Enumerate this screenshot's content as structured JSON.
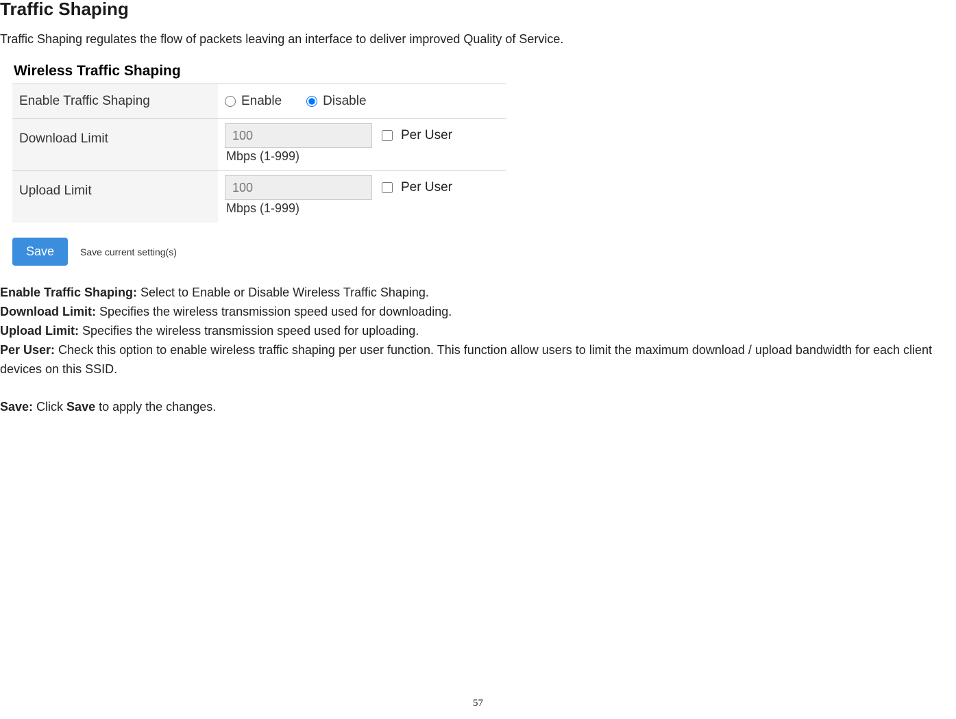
{
  "page": {
    "title": "Traffic Shaping",
    "intro": "Traffic Shaping regulates the flow of packets leaving an interface to deliver improved Quality of Service.",
    "pageNumber": "57"
  },
  "panel": {
    "heading": "Wireless Traffic Shaping",
    "enable": {
      "label": "Enable Traffic Shaping",
      "enableText": "Enable",
      "disableText": "Disable"
    },
    "download": {
      "label": "Download Limit",
      "value": "100",
      "unit": "Mbps (1-999)",
      "perUser": "Per User"
    },
    "upload": {
      "label": "Upload Limit",
      "value": "100",
      "unit": "Mbps (1-999)",
      "perUser": "Per User"
    },
    "saveButton": "Save",
    "saveHint": "Save current setting(s)"
  },
  "definitions": {
    "enableLabel": "Enable Traffic Shaping:",
    "enableText": " Select to Enable or Disable Wireless Traffic Shaping.",
    "downloadLabel": "Download Limit:",
    "downloadText": " Specifies the wireless transmission speed used for downloading.",
    "uploadLabel": "Upload Limit:",
    "uploadText": " Specifies the wireless transmission speed used for uploading.",
    "perUserLabel": "Per User:",
    "perUserText": " Check this option to enable wireless traffic shaping per user function. This function allow users to limit the maximum download / upload bandwidth for each client devices on this SSID.",
    "saveLabel": "Save:",
    "saveTextPrefix": " Click ",
    "saveBold": "Save",
    "saveTextSuffix": " to apply the changes."
  }
}
